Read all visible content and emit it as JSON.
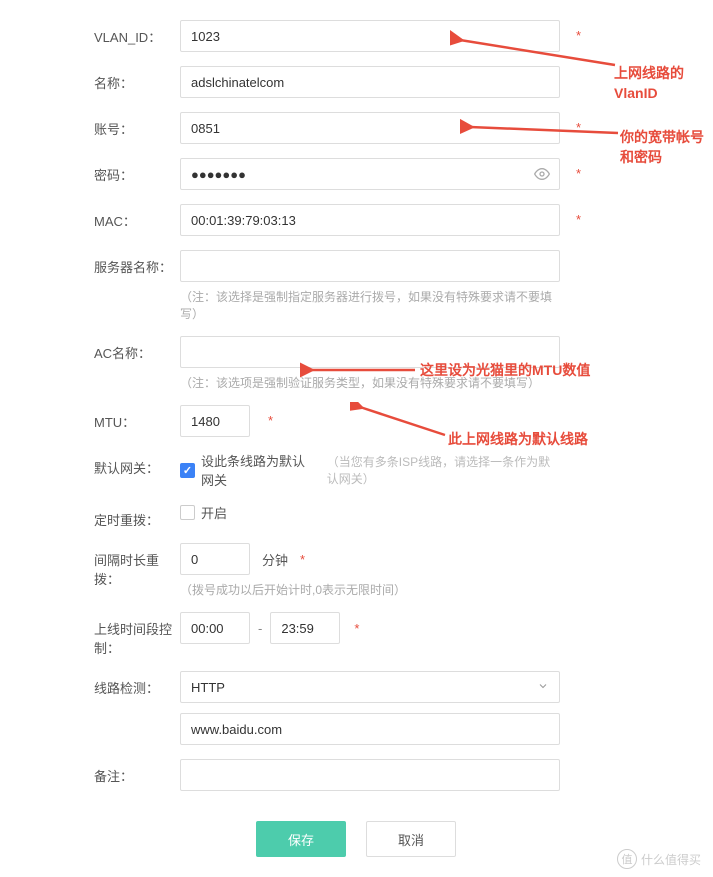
{
  "fields": {
    "vlan_id": {
      "label": "VLAN_ID：",
      "value": "1023"
    },
    "name": {
      "label": "名称：",
      "value": "adslchinatelcom"
    },
    "account": {
      "label": "账号：",
      "value": "0851"
    },
    "password": {
      "label": "密码：",
      "value": "●●●●●●●"
    },
    "mac": {
      "label": "MAC：",
      "value": "00:01:39:79:03:13"
    },
    "server_name": {
      "label": "服务器名称：",
      "value": "",
      "hint": "（注：该选择是强制指定服务器进行拨号，如果没有特殊要求请不要填写）"
    },
    "ac_name": {
      "label": "AC名称：",
      "value": "",
      "hint": "（注：该选项是强制验证服务类型，如果没有特殊要求请不要填写）"
    },
    "mtu": {
      "label": "MTU：",
      "value": "1480"
    },
    "default_gateway": {
      "label": "默认网关：",
      "checkbox_label": "设此条线路为默认网关",
      "hint": "（当您有多条ISP线路，请选择一条作为默认网关）"
    },
    "scheduled_redial": {
      "label": "定时重拨：",
      "checkbox_label": "开启"
    },
    "interval_redial": {
      "label": "间隔时长重拨：",
      "value": "0",
      "unit": "分钟",
      "hint": "（拨号成功以后开始计时,0表示无限时间）"
    },
    "online_time": {
      "label": "上线时间段控制：",
      "start": "00:00",
      "end": "23:59"
    },
    "line_detect": {
      "label": "线路检测：",
      "value": "HTTP",
      "url": "www.baidu.com"
    },
    "remark": {
      "label": "备注：",
      "value": ""
    }
  },
  "buttons": {
    "save": "保存",
    "cancel": "取消"
  },
  "annotations": {
    "a1": "上网线路的VlanID",
    "a2": "你的宽带帐号和密码",
    "a3": "这里设为光猫里的MTU数值",
    "a4": "此上网线路为默认线路"
  },
  "watermark": {
    "badge": "值",
    "text": "什么值得买"
  }
}
